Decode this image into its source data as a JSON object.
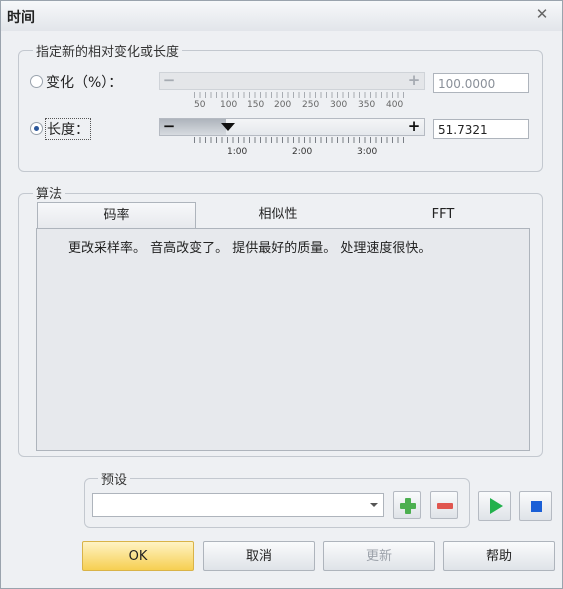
{
  "window": {
    "title": "时间"
  },
  "relative_change": {
    "legend": "指定新的相对变化或长度",
    "percent": {
      "label": "变化（%）：",
      "value": "100.0000",
      "ticks": [
        "50",
        "100",
        "150",
        "200",
        "250",
        "300",
        "350",
        "400"
      ],
      "selected": false
    },
    "length": {
      "label": "长度：",
      "value": "51.7321",
      "ticks": [
        "1:00",
        "2:00",
        "3:00"
      ],
      "selected": true
    }
  },
  "algorithm": {
    "legend": "算法",
    "tabs": [
      "码率",
      "相似性",
      "FFT"
    ],
    "active_tab": "码率",
    "description": "更改采样率。 音高改变了。 提供最好的质量。 处理速度很快。"
  },
  "presets": {
    "legend": "预设",
    "value": ""
  },
  "buttons": {
    "ok": "OK",
    "cancel": "取消",
    "update": "更新",
    "help": "帮助"
  },
  "colors": {
    "play": "#22b14c",
    "stop": "#1a5fd6",
    "add": "#4caf50",
    "remove": "#e0564f",
    "accent": "#f6cf52"
  }
}
